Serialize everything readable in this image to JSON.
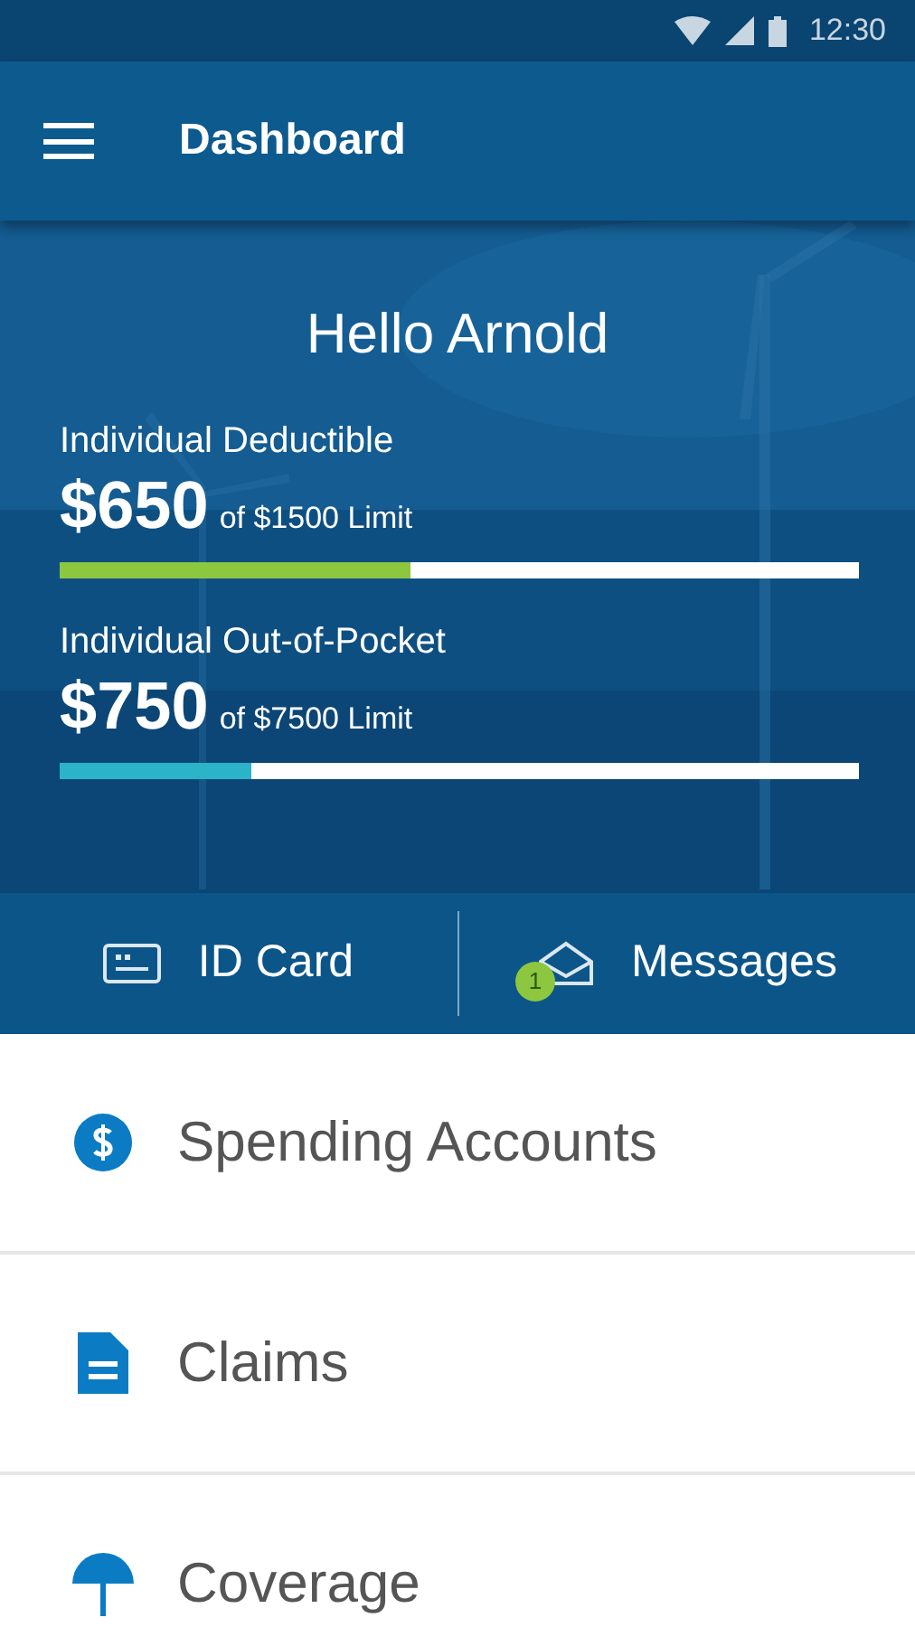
{
  "status_bar": {
    "time": "12:30"
  },
  "app_bar": {
    "title": "Dashboard"
  },
  "summary": {
    "greeting": "Hello Arnold",
    "meters": [
      {
        "label": "Individual Deductible",
        "amount": "$650",
        "limit": "of $1500 Limit",
        "level": 0.44,
        "color": "#8dc63f"
      },
      {
        "label": "Individual Out-of-Pocket",
        "amount": "$750",
        "limit": "of $7500 Limit",
        "level": 0.24,
        "color": "#2bb3c8"
      }
    ]
  },
  "actions": [
    {
      "kind": "card",
      "label": "ID Card"
    },
    {
      "kind": "messages",
      "label": "Messages",
      "badge": "1"
    }
  ],
  "menu": [
    {
      "kind": "dollar",
      "label": "Spending Accounts"
    },
    {
      "kind": "document",
      "label": "Claims"
    },
    {
      "kind": "umbrella",
      "label": "Coverage"
    }
  ]
}
